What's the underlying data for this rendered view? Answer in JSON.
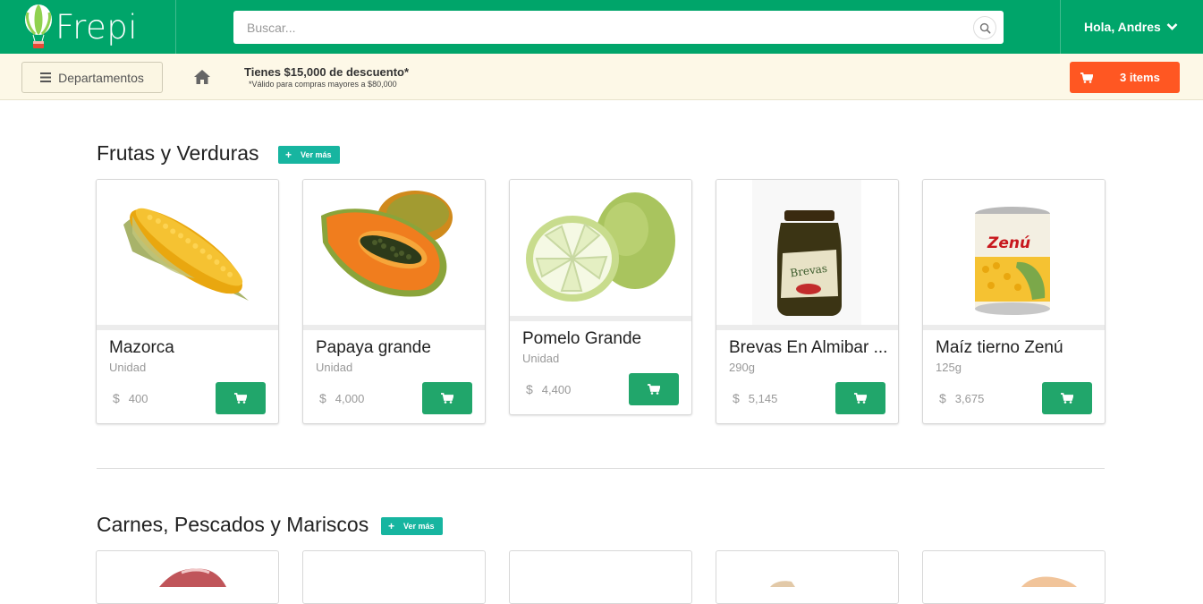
{
  "header": {
    "logo_text": "Frepi",
    "search_placeholder": "Buscar...",
    "greeting": "Hola, Andres"
  },
  "subbar": {
    "departments_label": "Departamentos",
    "promo_title": "Tienes $15,000 de descuento*",
    "promo_note": "*Válido para compras mayores a $80,000",
    "cart_label": "3 items"
  },
  "colors": {
    "brand": "#00a56a",
    "cart": "#ff5722",
    "vermas": "#17b5a0",
    "add_button": "#21a66b"
  },
  "sections": [
    {
      "title": "Frutas y Verduras",
      "more_label": "Ver más",
      "products": [
        {
          "name": "Mazorca",
          "unit": "Unidad",
          "currency": "$",
          "price": "400",
          "image": "corn"
        },
        {
          "name": "Papaya grande",
          "unit": "Unidad",
          "currency": "$",
          "price": "4,000",
          "image": "papaya"
        },
        {
          "name": "Pomelo Grande",
          "unit": "Unidad",
          "currency": "$",
          "price": "4,400",
          "image": "pomelo"
        },
        {
          "name": "Brevas En Almibar ...",
          "unit": "290g",
          "currency": "$",
          "price": "5,145",
          "image": "jar"
        },
        {
          "name": "Maíz tierno Zenú",
          "unit": "125g",
          "currency": "$",
          "price": "3,675",
          "image": "can"
        }
      ]
    },
    {
      "title": "Carnes, Pescados y Mariscos",
      "more_label": "Ver más"
    }
  ]
}
